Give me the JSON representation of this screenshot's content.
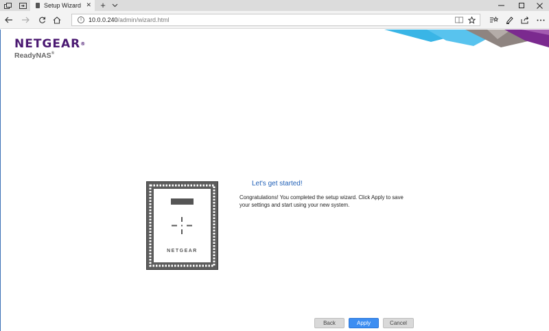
{
  "browser": {
    "tab_title": "Setup Wizard",
    "new_tab": "+",
    "url_host": "10.0.0.240",
    "url_path": "/admin/wizard.html",
    "info_glyph": "i"
  },
  "logo": {
    "brand": "NETGEAR",
    "registered": "®",
    "product": "ReadyNAS",
    "product_mark": "®"
  },
  "device": {
    "brand": "NETGEAR"
  },
  "wizard": {
    "heading": "Let's get started!",
    "message": "Congratulations! You completed the setup wizard. Click Apply to save your settings and start using your new system."
  },
  "buttons": {
    "back": "Back",
    "apply": "Apply",
    "cancel": "Cancel"
  },
  "colors": {
    "brand_purple": "#4b1a72",
    "heading_blue": "#1f5fb6",
    "apply_blue": "#3d8ef2",
    "banner_cyan": "#39b5e6",
    "banner_purple": "#7b2a8f",
    "banner_taupe": "#8e8480"
  }
}
